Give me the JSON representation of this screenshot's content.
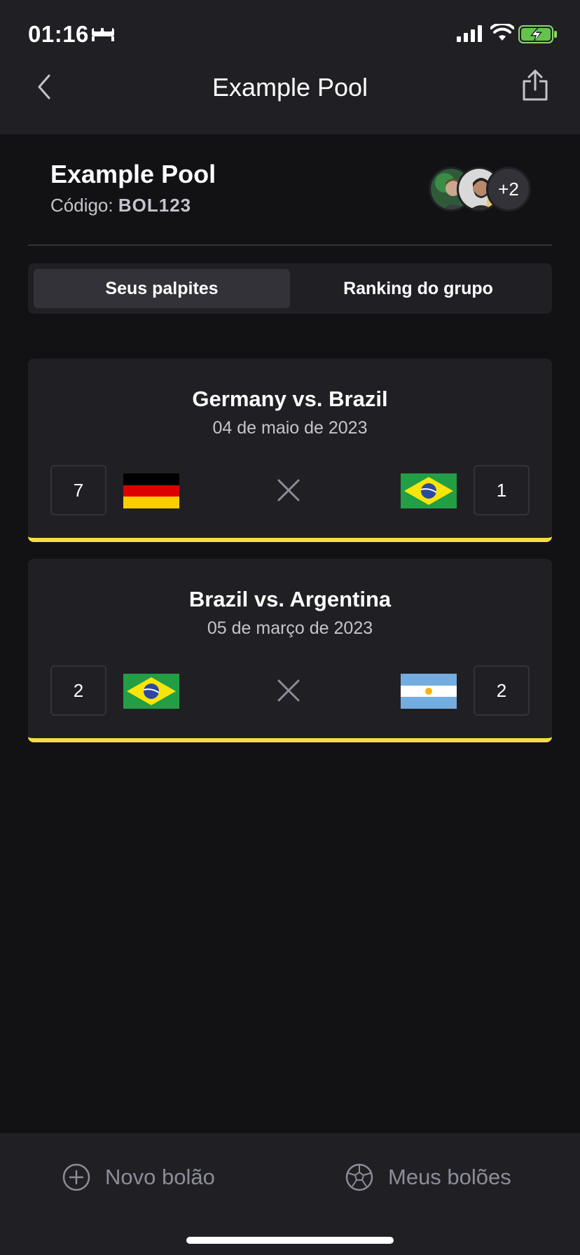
{
  "status_bar": {
    "time": "01:16"
  },
  "header": {
    "title": "Example Pool"
  },
  "pool": {
    "name": "Example Pool",
    "code_label": "Código:",
    "code": "BOL123",
    "participants_extra": "+2"
  },
  "tabs": [
    {
      "label": "Seus palpites",
      "active": true
    },
    {
      "label": "Ranking do grupo",
      "active": false
    }
  ],
  "games": [
    {
      "title": "Germany vs. Brazil",
      "date": "04 de maio de 2023",
      "home_score": "7",
      "away_score": "1",
      "home_flag": "germany-flag",
      "away_flag": "brazil-flag"
    },
    {
      "title": "Brazil vs. Argentina",
      "date": "05 de março de 2023",
      "home_score": "2",
      "away_score": "2",
      "home_flag": "brazil-flag",
      "away_flag": "argentina-flag"
    }
  ],
  "bottom_nav": [
    {
      "label": "Novo bolão",
      "icon": "plus-circle-icon"
    },
    {
      "label": "Meus bolões",
      "icon": "soccer-ball-icon"
    }
  ],
  "colors": {
    "background": "#121214",
    "surface": "#202024",
    "accent_yellow": "#F7DD43",
    "text_primary": "#FFFFFF",
    "text_secondary": "#C4C4CC",
    "muted": "#8D8D99"
  }
}
